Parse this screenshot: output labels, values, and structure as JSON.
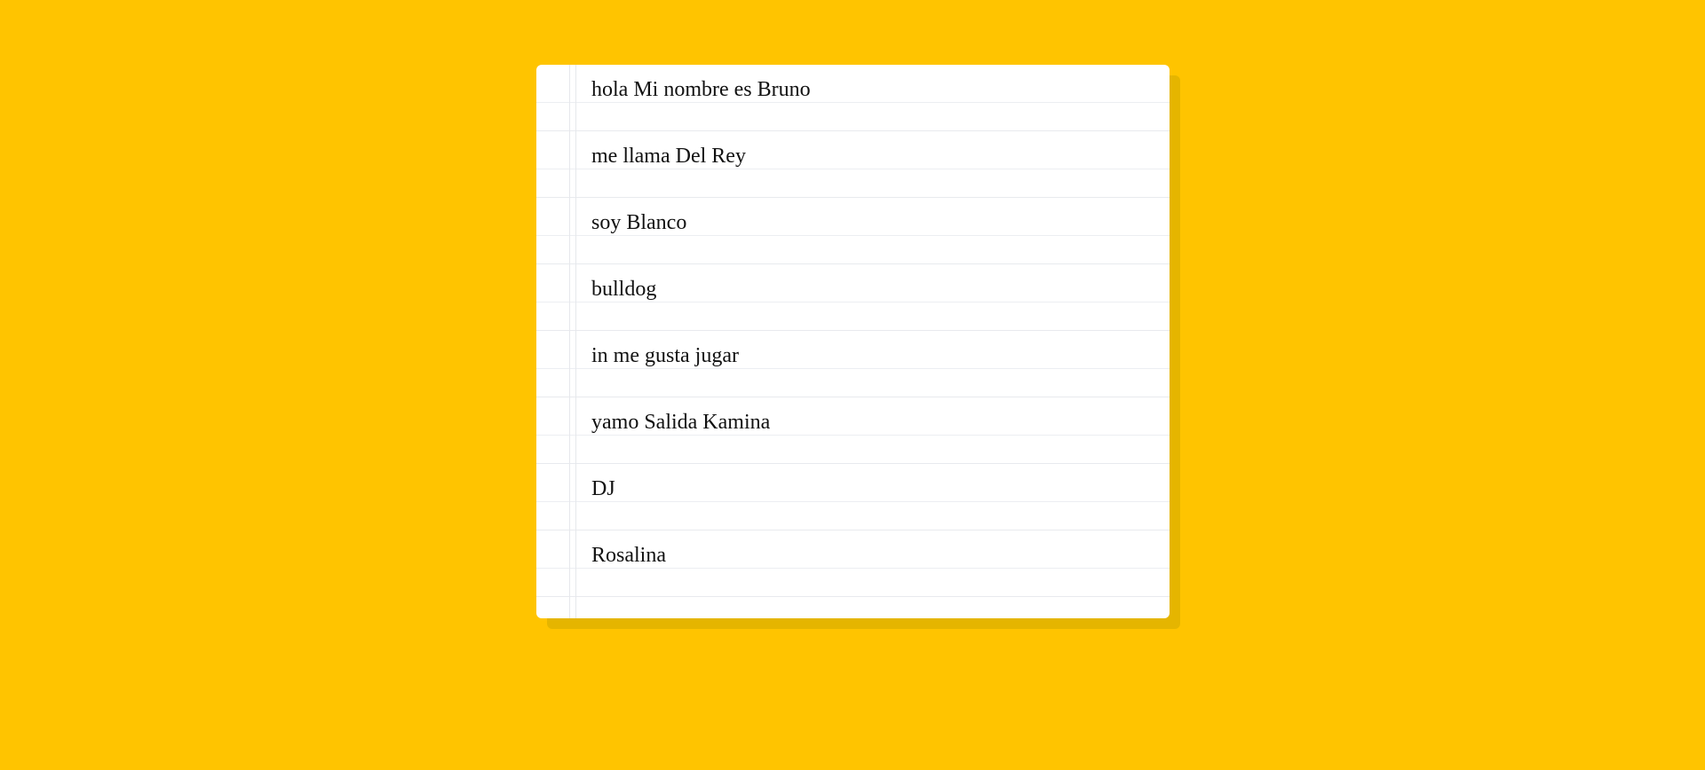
{
  "colors": {
    "background": "#FFC400",
    "paper": "#FFFFFF",
    "shadow": "#E5B500",
    "ruled_line": "#ECEEF2",
    "text": "#111111"
  },
  "note": {
    "lines": [
      "hola Mi nombre es Bruno",
      "me llama Del Rey",
      "soy Blanco",
      "bulldog",
      "in me gusta jugar",
      "yamo Salida Kamina",
      "DJ",
      "Rosalina"
    ]
  }
}
